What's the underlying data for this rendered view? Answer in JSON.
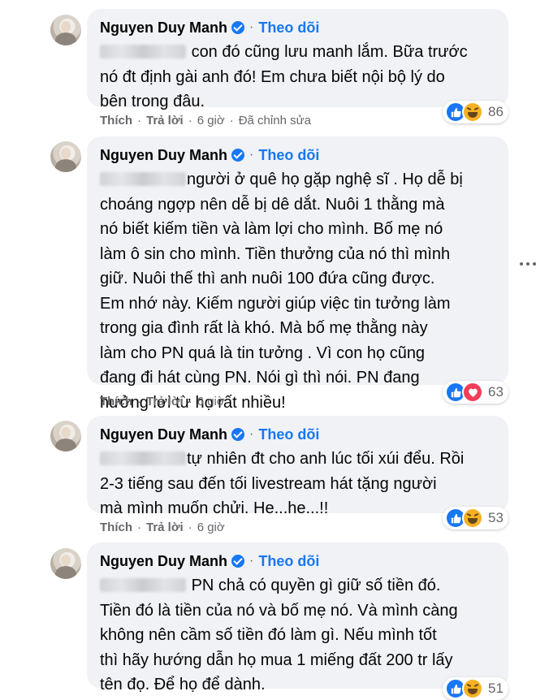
{
  "comments": [
    {
      "author": "Nguyen Duy Manh",
      "follow": "Theo dõi",
      "lines": [
        "con đó cũng lưu manh lắm. Bữa trước",
        "nó đt định gài anh đó! Em chưa biết nội bộ lý do",
        "bên trong đâu."
      ],
      "like": "Thích",
      "reply": "Trả lời",
      "time": "6 giờ",
      "edited": "Đã chỉnh sửa",
      "reaction_icons": [
        "like-icon",
        "haha-icon"
      ],
      "reaction_count": "86"
    },
    {
      "author": "Nguyen Duy Manh",
      "follow": "Theo dõi",
      "lines": [
        "người ở quê họ gặp nghệ sĩ . Họ dễ bị",
        "choáng ngợp nên dễ bị dê dắt. Nuôi 1 thằng mà",
        "nó biết kiếm tiền và làm lợi cho mình. Bố mẹ nó",
        "làm ô sin cho mình. Tiền thưởng của nó thì mình",
        "giữ. Nuôi thế thì anh nuôi 100 đứa cũng được.",
        "Em nhớ này. Kiếm người giúp việc tin tưởng làm",
        "trong gia đình rất là khó. Mà bố mẹ thằng này",
        "làm cho PN quá là tin tưởng . Vì con họ cũng",
        "đang đi hát cùng PN. Nói gì thì nói. PN đang",
        "hưởng lơi từ họ rất nhiều!"
      ],
      "like": "Thích",
      "reply": "Trả lời",
      "time": "6 giờ",
      "reaction_icons": [
        "like-icon",
        "love-icon"
      ],
      "reaction_count": "63"
    },
    {
      "author": "Nguyen Duy Manh",
      "follow": "Theo dõi",
      "lines": [
        "tự nhiên đt cho anh lúc tối xúi đểu. Rồi",
        "2-3 tiếng sau đến tối livestream hát tặng người",
        "mà mình muốn chửi. He...he...!!"
      ],
      "like": "Thích",
      "reply": "Trả lời",
      "time": "6 giờ",
      "reaction_icons": [
        "like-icon",
        "haha-icon"
      ],
      "reaction_count": "53"
    },
    {
      "author": "Nguyen Duy Manh",
      "follow": "Theo dõi",
      "lines": [
        "PN chả có quyền gì giữ số tiền đó.",
        "Tiền đó là tiền của nó và bố mẹ nó. Và mình càng",
        "không nên cầm số tiền đó làm gì. Nếu mình tốt",
        "thì hãy hướng dẫn họ mua 1 miếng đất 200 tr lấy",
        "tên đọ. Để họ để dành."
      ],
      "reaction_icons": [
        "like-icon",
        "haha-icon"
      ],
      "reaction_count": "51"
    }
  ],
  "colors": {
    "accent": "#1877f2",
    "bubble": "#f0f2f5",
    "meta": "#65676b"
  }
}
